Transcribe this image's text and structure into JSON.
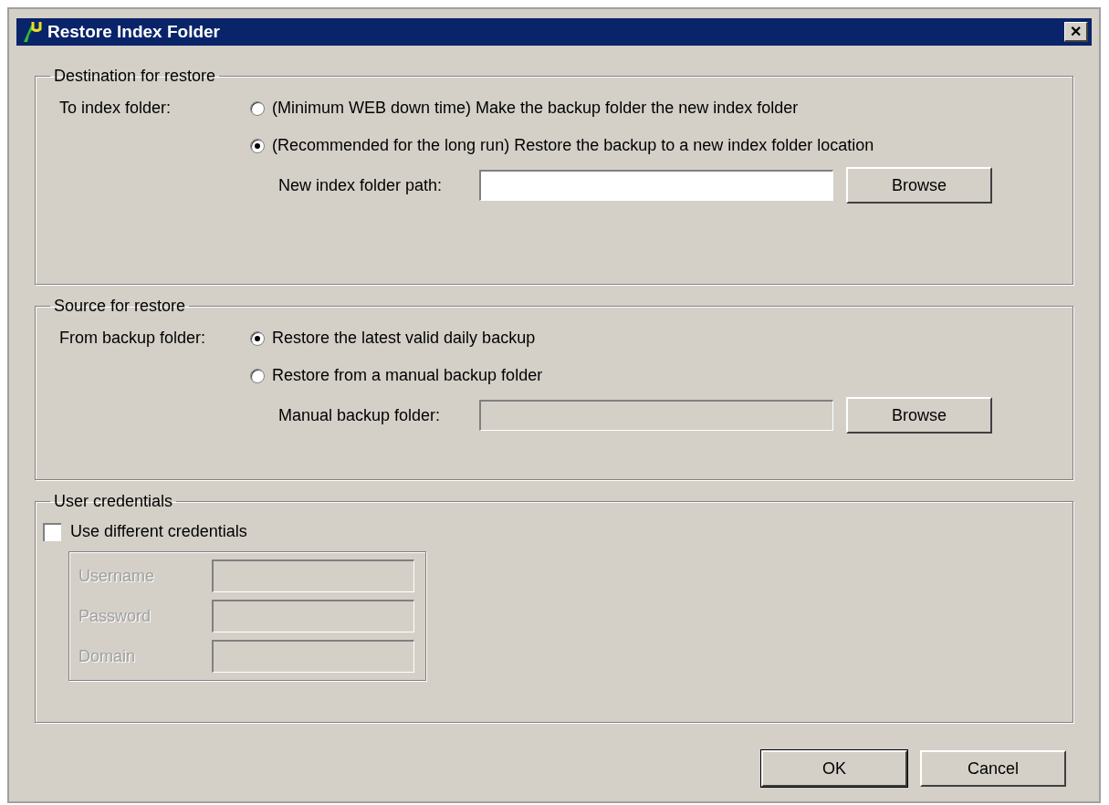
{
  "window": {
    "title": "Restore Index Folder",
    "close": "✕"
  },
  "destination": {
    "title": "Destination for restore",
    "label": "To index folder:",
    "options": [
      {
        "label": "(Minimum WEB down time) Make the backup folder the new index folder",
        "selected": false
      },
      {
        "label": "(Recommended for the long run) Restore the backup to a new index folder location",
        "selected": true
      }
    ],
    "path_field": {
      "label": "New index folder path:",
      "disabled": false
    },
    "browse": "Browse"
  },
  "source": {
    "title": "Source for restore",
    "label": "From backup folder:",
    "options": [
      {
        "label": "Restore the latest valid daily backup",
        "selected": true
      },
      {
        "label": "Restore from a manual backup folder",
        "selected": false
      }
    ],
    "path_field": {
      "label": "Manual backup folder:",
      "disabled": true
    },
    "browse": "Browse"
  },
  "credentials": {
    "title": "User credentials",
    "checkbox": {
      "label": "Use different credentials",
      "checked": false
    },
    "fields": [
      {
        "label": "Username"
      },
      {
        "label": "Password"
      },
      {
        "label": "Domain"
      }
    ]
  },
  "buttons": [
    {
      "label": "OK",
      "default": true
    },
    {
      "label": "Cancel",
      "default": false
    }
  ]
}
